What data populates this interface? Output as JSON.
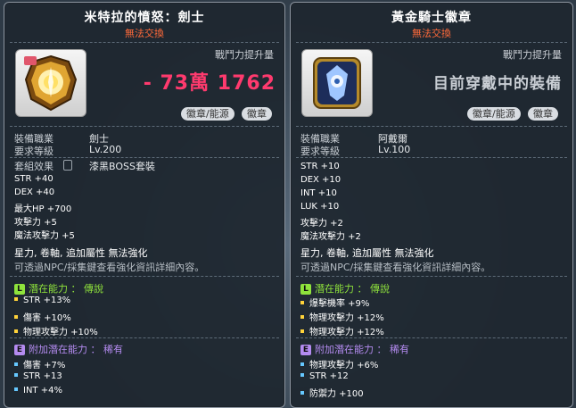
{
  "left": {
    "title": "米特拉的憤怒：劍士",
    "untradeable": "無法交換",
    "power_label": "戰鬥力提升量",
    "power_value": "- 73萬 1762",
    "btn_source": "徽章/能源",
    "btn_badge": "徽章",
    "job_label": "裝備職業",
    "job_value": "劍士",
    "level_label": "要求等級",
    "level_value": "Lv.200",
    "set_label": "套組效果",
    "set_value": "漆黑BOSS套裝",
    "stats": [
      "STR  +40",
      "DEX  +40",
      "最大HP  +700",
      "攻擊力  +5",
      "魔法攻擊力  +5"
    ],
    "props": "星力, 卷軸, 追加屬性 無法強化",
    "note": "可透過NPC/採集鍵查看強化資訊詳細內容。",
    "potential_badge": "L",
    "potential_title": "潛在能力 ： 傳說",
    "potential_lines": [
      "STR +13%",
      "傷害 +10%",
      "物理攻擊力 +10%"
    ],
    "addpot_badge": "E",
    "addpot_title": "附加潛在能力 ： 稀有",
    "addpot_lines": [
      "傷害 +7%",
      "STR +13",
      "INT +4%"
    ]
  },
  "right": {
    "title": "黃金騎士徽章",
    "untradeable": "無法交換",
    "power_label": "戰鬥力提升量",
    "power_text": "目前穿戴中的裝備",
    "btn_source": "徽章/能源",
    "btn_badge": "徽章",
    "job_label": "裝備職業",
    "job_value": "阿戴爾",
    "level_label": "要求等級",
    "level_value": "Lv.100",
    "stats": [
      "STR  +10",
      "DEX  +10",
      "INT  +10",
      "LUK  +10",
      "攻擊力  +2",
      "魔法攻擊力  +2"
    ],
    "props": "星力, 卷軸, 追加屬性 無法強化",
    "note": "可透過NPC/採集鍵查看強化資訊詳細內容。",
    "potential_badge": "L",
    "potential_title": "潛在能力 ： 傳說",
    "potential_lines": [
      "爆擊機率 +9%",
      "物理攻擊力 +12%",
      "物理攻擊力 +12%"
    ],
    "addpot_badge": "E",
    "addpot_title": "附加潛在能力 ： 稀有",
    "addpot_lines": [
      "物理攻擊力 +6%",
      "STR +12",
      "防禦力 +100"
    ]
  },
  "colors": {
    "legendary": "#8fe33c",
    "rare_addpot": "#b48bf0",
    "power_negative": "#ff3a6e",
    "untradeable": "#ff6a3a"
  },
  "icons": {
    "left_item": "mitra-rage-emblem-icon",
    "right_item": "golden-knight-badge-icon",
    "lock": "lock-icon"
  }
}
